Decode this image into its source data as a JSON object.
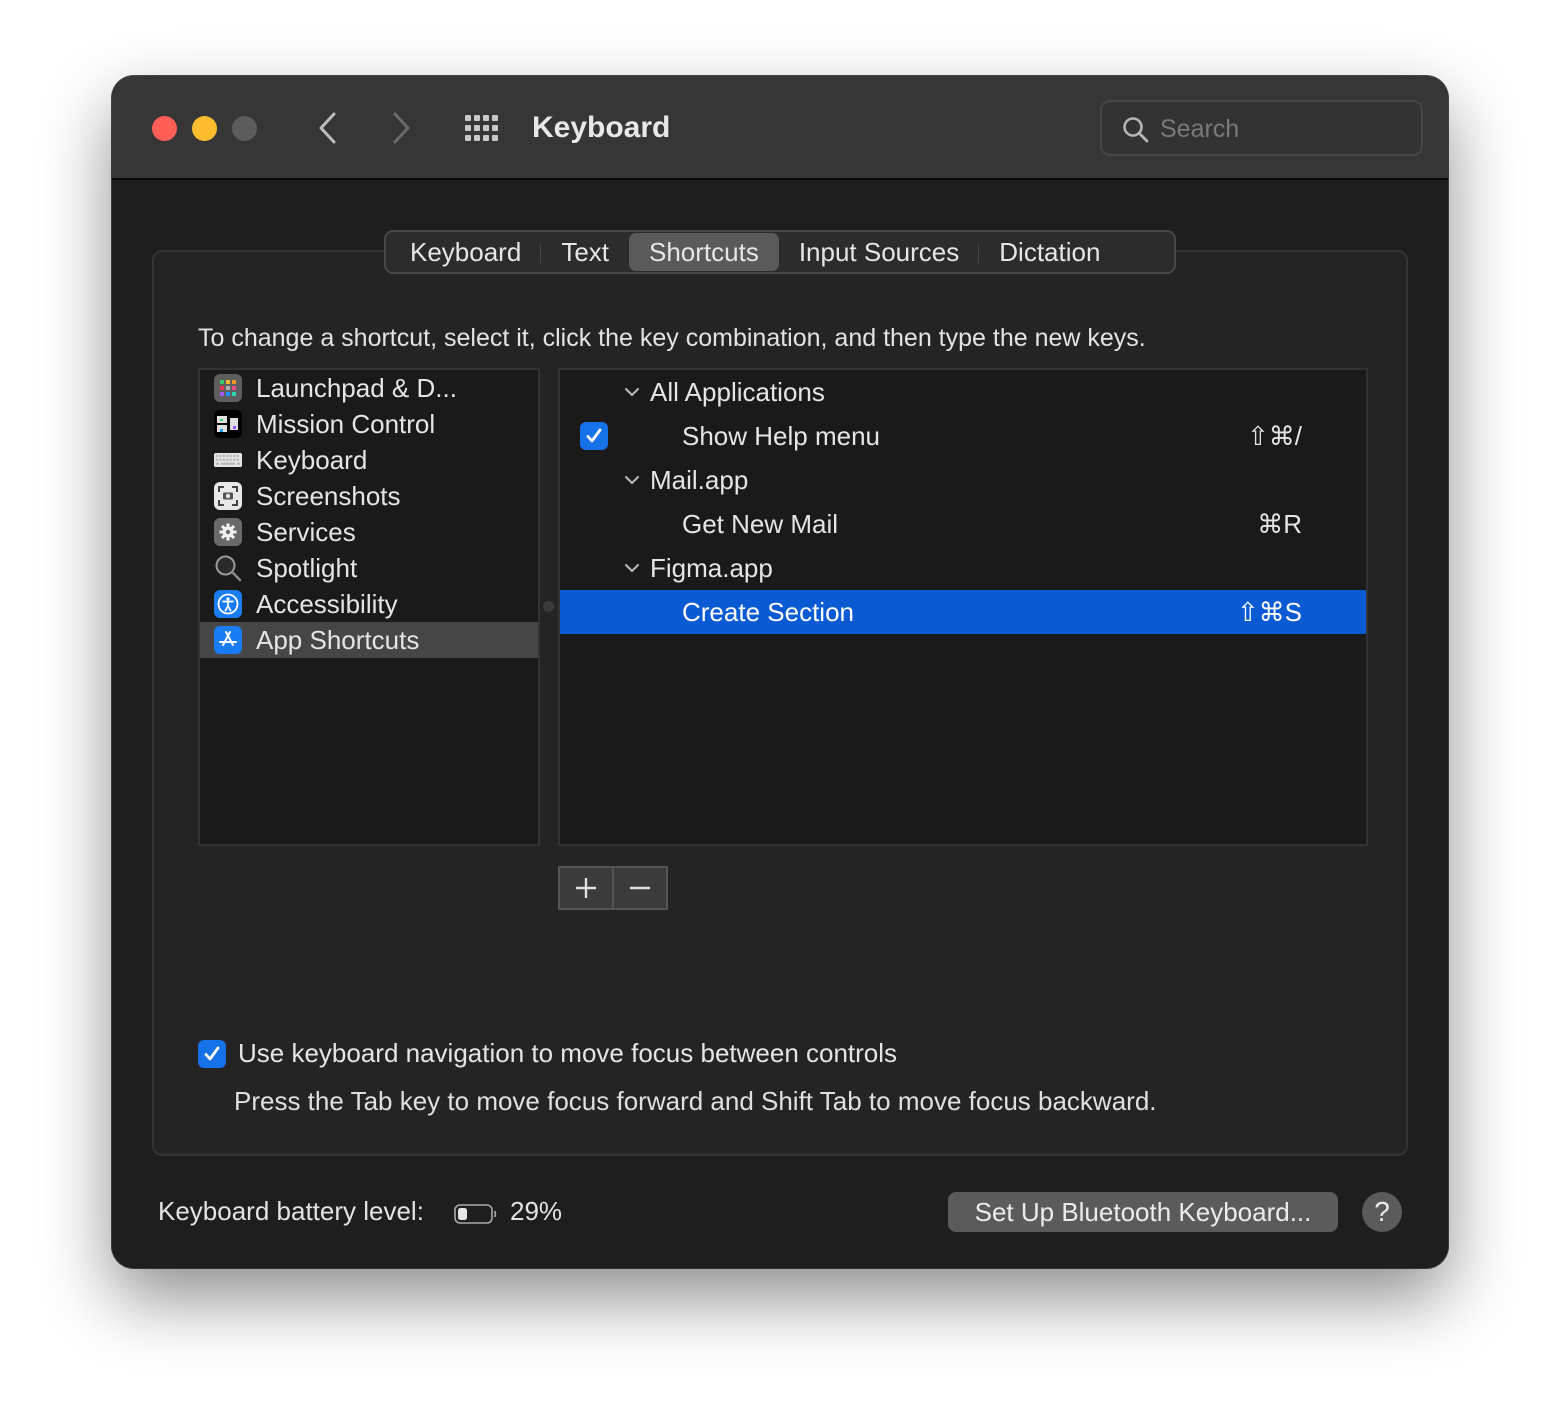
{
  "window": {
    "title": "Keyboard",
    "search": {
      "placeholder": "Search",
      "value": ""
    }
  },
  "tabs": [
    {
      "label": "Keyboard",
      "active": false
    },
    {
      "label": "Text",
      "active": false
    },
    {
      "label": "Shortcuts",
      "active": true
    },
    {
      "label": "Input Sources",
      "active": false
    },
    {
      "label": "Dictation",
      "active": false
    }
  ],
  "instruction": "To change a shortcut, select it, click the key combination, and then type the new keys.",
  "categories": [
    {
      "label": "Launchpad & D...",
      "icon": "launchpad-icon",
      "selected": false
    },
    {
      "label": "Mission Control",
      "icon": "mission-control-icon",
      "selected": false
    },
    {
      "label": "Keyboard",
      "icon": "keyboard-icon",
      "selected": false
    },
    {
      "label": "Screenshots",
      "icon": "screenshot-icon",
      "selected": false
    },
    {
      "label": "Services",
      "icon": "gear-icon",
      "selected": false
    },
    {
      "label": "Spotlight",
      "icon": "magnifier-icon",
      "selected": false
    },
    {
      "label": "Accessibility",
      "icon": "accessibility-icon",
      "selected": false
    },
    {
      "label": "App Shortcuts",
      "icon": "app-store-icon",
      "selected": true
    }
  ],
  "shortcuts": [
    {
      "type": "group",
      "label": "All Applications",
      "expanded": true
    },
    {
      "type": "item",
      "label": "Show Help menu",
      "keys": "⇧⌘/",
      "checked": true,
      "selected": false
    },
    {
      "type": "group",
      "label": "Mail.app",
      "expanded": true
    },
    {
      "type": "item",
      "label": "Get New Mail",
      "keys": "⌘R",
      "checked": null,
      "selected": false
    },
    {
      "type": "group",
      "label": "Figma.app",
      "expanded": true
    },
    {
      "type": "item",
      "label": "Create Section",
      "keys": "⇧⌘S",
      "checked": null,
      "selected": true
    }
  ],
  "list_controls": {
    "add_label": "+",
    "remove_label": "−"
  },
  "keyboard_navigation": {
    "checked": true,
    "label": "Use keyboard navigation to move focus between controls",
    "help": "Press the Tab key to move focus forward and Shift Tab to move focus backward."
  },
  "footer": {
    "battery_label": "Keyboard battery level:",
    "battery_percent": 29,
    "battery_value": "29%",
    "bluetooth_button": "Set Up Bluetooth Keyboard...",
    "help_label": "?"
  },
  "colors": {
    "accent": "#0a5bd3",
    "checkbox": "#1572e8",
    "close": "#ff5f57",
    "minimize": "#febc2e",
    "zoom_disabled": "#5c5c5c"
  }
}
